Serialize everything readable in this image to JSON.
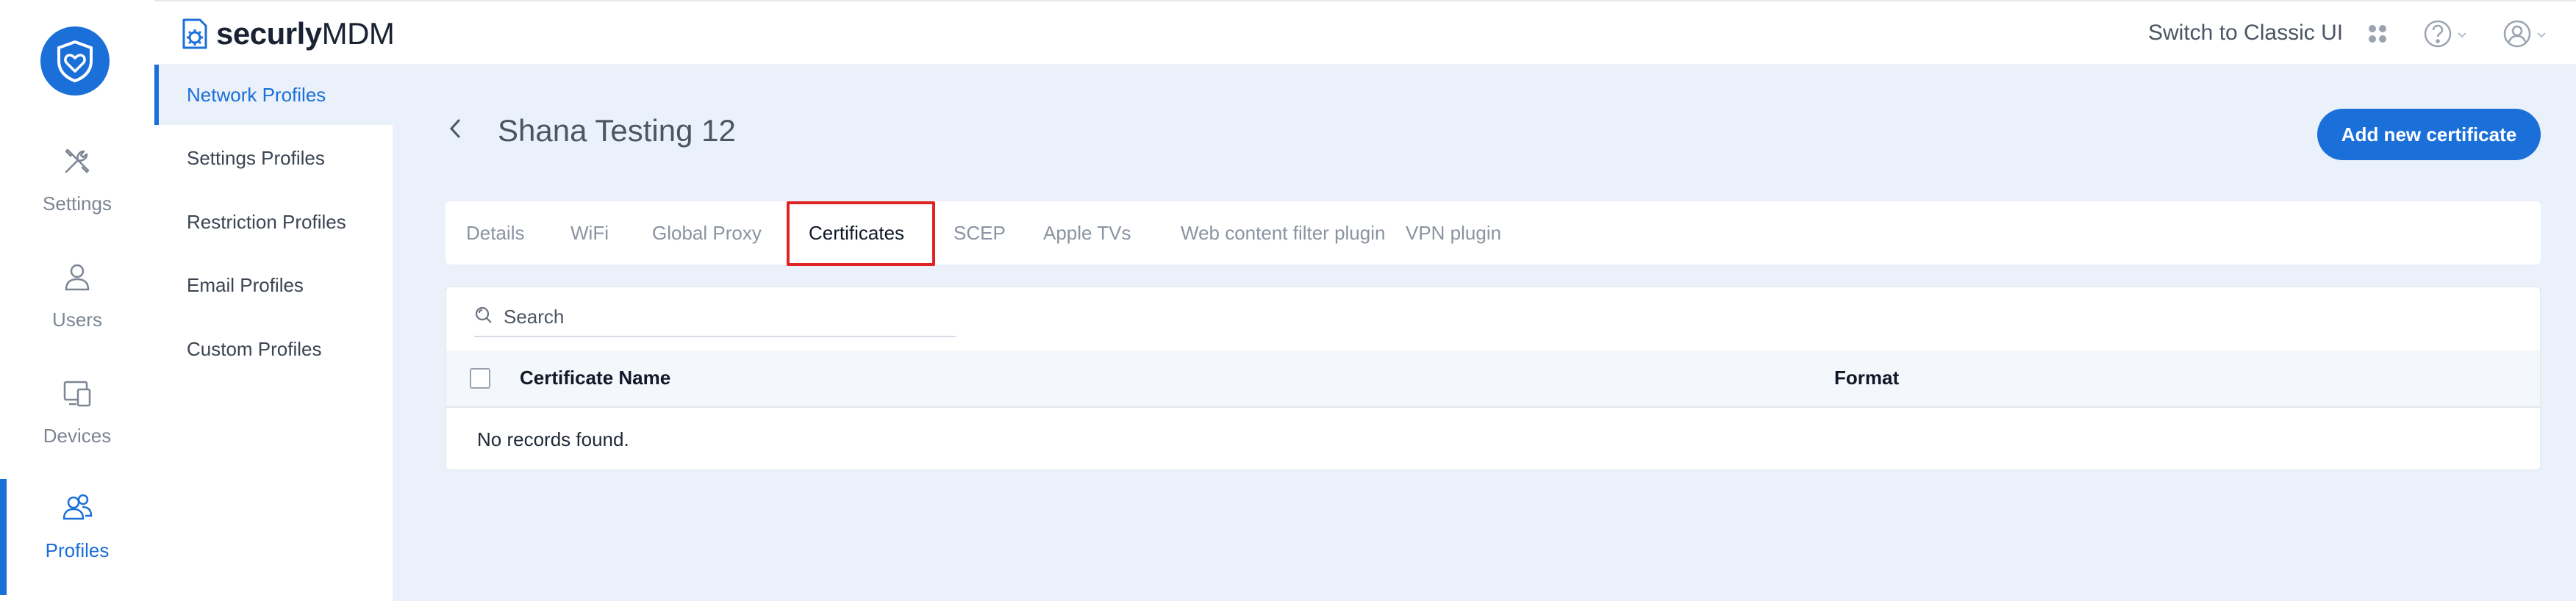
{
  "app": {
    "brand_prefix": "securly",
    "brand_suffix": "MDM",
    "accent_color": "#1b6fd8",
    "highlight_color": "#e02424"
  },
  "rail": {
    "items": [
      {
        "label": "Settings",
        "icon": "wrench-screwdriver-icon",
        "active": false
      },
      {
        "label": "Users",
        "icon": "user-icon",
        "active": false
      },
      {
        "label": "Devices",
        "icon": "devices-icon",
        "active": false
      },
      {
        "label": "Profiles",
        "icon": "profiles-icon",
        "active": true
      }
    ]
  },
  "topbar": {
    "switch_label": "Switch to Classic UI",
    "apps_icon": "apps-grid-icon",
    "help_icon": "help-icon",
    "account_icon": "account-icon"
  },
  "subnav": {
    "items": [
      {
        "label": "Network Profiles",
        "active": true
      },
      {
        "label": "Settings Profiles",
        "active": false
      },
      {
        "label": "Restriction Profiles",
        "active": false
      },
      {
        "label": "Email Profiles",
        "active": false
      },
      {
        "label": "Custom Profiles",
        "active": false
      }
    ]
  },
  "page": {
    "title": "Shana Testing 12",
    "add_button_label": "Add new certificate"
  },
  "tabs": [
    {
      "label": "Details",
      "active": false
    },
    {
      "label": "WiFi",
      "active": false
    },
    {
      "label": "Global Proxy",
      "active": false
    },
    {
      "label": "Certificates",
      "active": true
    },
    {
      "label": "SCEP",
      "active": false
    },
    {
      "label": "Apple TVs",
      "active": false
    },
    {
      "label": "Web content filter plugin",
      "active": false
    },
    {
      "label": "VPN plugin",
      "active": false
    }
  ],
  "table": {
    "search_placeholder": "Search",
    "columns": [
      "Certificate Name",
      "Format"
    ],
    "rows": [],
    "empty_message": "No records found."
  }
}
